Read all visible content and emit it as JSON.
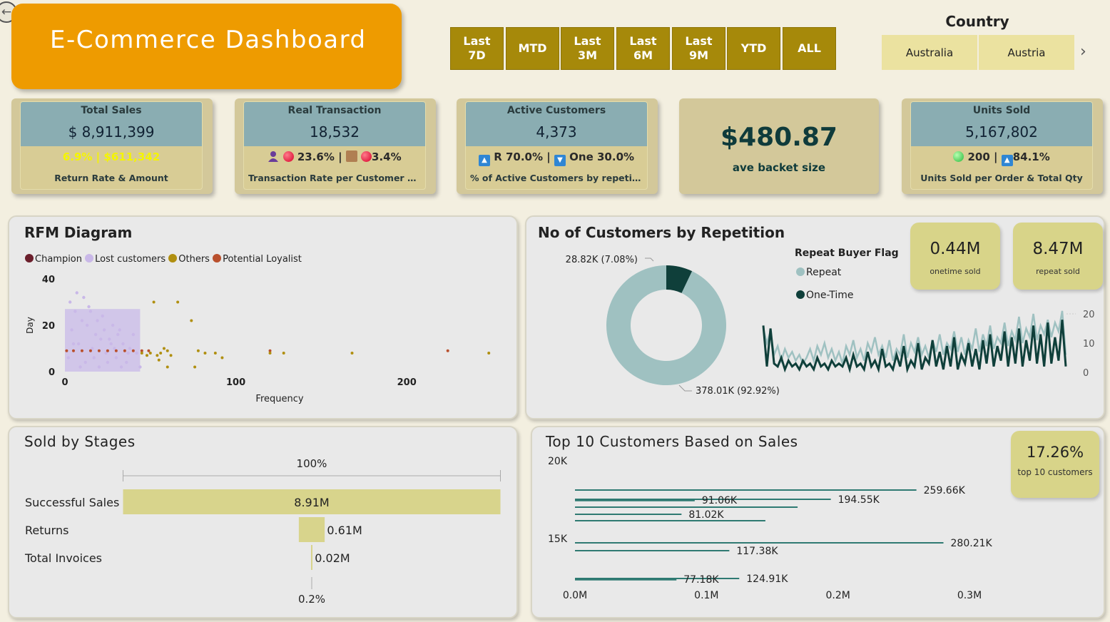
{
  "header": {
    "title": "E-Commerce Dashboard",
    "back_icon": "arrow-left-circle-icon"
  },
  "periods": [
    "Last\n7D",
    "MTD",
    "Last\n3M",
    "Last\n6M",
    "Last\n9M",
    "YTD",
    "ALL"
  ],
  "country": {
    "label": "Country",
    "items": [
      "Australia",
      "Austria"
    ],
    "next_icon": "chevron-right-icon"
  },
  "kpis": {
    "total_sales": {
      "title": "Total Sales",
      "value": "$ 8,911,399",
      "rate": "6.9%",
      "sep": "|",
      "amount": "$611,342",
      "subtitle": "Return Rate & Amount",
      "highlight_color": "#f5f500"
    },
    "real_transaction": {
      "title": "Real Transaction",
      "value": "18,532",
      "rate1": "23.6% |",
      "rate2": "3.4%",
      "subtitle": "Transaction Rate per Customer & Tot..."
    },
    "active_customers": {
      "title": "Active Customers",
      "value": "4,373",
      "repeat": "R 70.0% |",
      "one": "One 30.0%",
      "subtitle": "% of Active Customers by repetition"
    },
    "basket": {
      "value": "$480.87",
      "label": "ave backet size"
    },
    "units_sold": {
      "title": "Units Sold",
      "value": "5,167,802",
      "per_order": "200 |",
      "pct": "84.1%",
      "subtitle": "Units Sold per Order & Total Qty"
    }
  },
  "rfm": {
    "title": "RFM Diagram",
    "legend": [
      {
        "name": "Champion",
        "color": "#6b1f2c"
      },
      {
        "name": "Lost customers",
        "color": "#c9b8e8"
      },
      {
        "name": "Others",
        "color": "#b08f10"
      },
      {
        "name": "Potential Loyalist",
        "color": "#b9502d"
      }
    ]
  },
  "repetition": {
    "title": "No of Customers by Repetition",
    "legend_title": "Repeat Buyer Flag",
    "legend": [
      {
        "name": "Repeat",
        "color": "#9fc1c1"
      },
      {
        "name": "One-Time",
        "color": "#0f3f3a"
      }
    ],
    "onetime": {
      "value": "0.44M",
      "label": "onetime sold"
    },
    "repeat": {
      "value": "8.47M",
      "label": "repeat sold"
    }
  },
  "stages": {
    "title": "Sold by Stages"
  },
  "top10": {
    "title": "Top 10 Customers Based on Sales",
    "card_value": "17.26%",
    "card_label": "top 10 customers"
  },
  "chart_data": [
    {
      "id": "rfm",
      "type": "scatter",
      "title": "RFM Diagram",
      "xlabel": "Frequency",
      "ylabel": "Day",
      "xlim": [
        0,
        250
      ],
      "ylim": [
        0,
        40
      ],
      "xticks": [
        "0",
        "100",
        "200"
      ],
      "yticks": [
        "0",
        "20",
        "40"
      ],
      "series": [
        {
          "name": "Lost customers",
          "points": [
            [
              2,
              6
            ],
            [
              4,
              18
            ],
            [
              6,
              26
            ],
            [
              8,
              12
            ],
            [
              10,
              22
            ],
            [
              12,
              4
            ],
            [
              14,
              28
            ],
            [
              16,
              10
            ],
            [
              18,
              16
            ],
            [
              20,
              2
            ],
            [
              22,
              24
            ],
            [
              24,
              8
            ],
            [
              26,
              14
            ],
            [
              28,
              20
            ],
            [
              30,
              6
            ],
            [
              32,
              18
            ],
            [
              34,
              12
            ],
            [
              36,
              4
            ],
            [
              38,
              10
            ],
            [
              40,
              16
            ],
            [
              42,
              8
            ],
            [
              44,
              2
            ],
            [
              3,
              30
            ],
            [
              7,
              34
            ],
            [
              11,
              32
            ],
            [
              5,
              12
            ],
            [
              9,
              2
            ],
            [
              13,
              20
            ],
            [
              17,
              6
            ],
            [
              21,
              14
            ],
            [
              25,
              4
            ],
            [
              29,
              10
            ],
            [
              33,
              2
            ],
            [
              37,
              8
            ],
            [
              15,
              26
            ],
            [
              19,
              22
            ],
            [
              23,
              18
            ],
            [
              27,
              12
            ],
            [
              31,
              16
            ]
          ]
        },
        {
          "name": "Potential Loyalist",
          "points": [
            [
              1,
              9
            ],
            [
              5,
              9
            ],
            [
              10,
              9
            ],
            [
              15,
              9
            ],
            [
              20,
              9
            ],
            [
              25,
              9
            ],
            [
              30,
              9
            ],
            [
              35,
              9
            ],
            [
              40,
              9
            ],
            [
              45,
              9
            ],
            [
              49,
              9
            ],
            [
              120,
              9
            ],
            [
              224,
              9
            ]
          ]
        },
        {
          "name": "Others",
          "points": [
            [
              52,
              30
            ],
            [
              66,
              30
            ],
            [
              74,
              22
            ],
            [
              45,
              8
            ],
            [
              48,
              7
            ],
            [
              50,
              8
            ],
            [
              54,
              7
            ],
            [
              56,
              8
            ],
            [
              55,
              5
            ],
            [
              58,
              10
            ],
            [
              60,
              9
            ],
            [
              62,
              7
            ],
            [
              60,
              2
            ],
            [
              76,
              2
            ],
            [
              78,
              9
            ],
            [
              82,
              8
            ],
            [
              88,
              8
            ],
            [
              92,
              6
            ],
            [
              120,
              8
            ],
            [
              128,
              8
            ],
            [
              168,
              8
            ],
            [
              248,
              8
            ]
          ]
        },
        {
          "name": "Champion",
          "points": []
        }
      ]
    },
    {
      "id": "repetition_donut",
      "type": "pie",
      "slices": [
        {
          "name": "One-Time",
          "value": 28.82,
          "label": "28.82K (7.08%)"
        },
        {
          "name": "Repeat",
          "value": 378.01,
          "label": "378.01K (92.92%)"
        }
      ]
    },
    {
      "id": "repetition_line",
      "type": "line",
      "ylim": [
        0,
        20
      ],
      "yticks": [
        "0",
        "10",
        "20"
      ],
      "series": [
        {
          "name": "Repeat",
          "values": [
            15,
            10,
            14,
            6,
            9,
            4,
            8,
            5,
            7,
            4,
            6,
            3,
            5,
            8,
            4,
            9,
            6,
            10,
            5,
            8,
            4,
            7,
            3,
            9,
            6,
            11,
            5,
            8,
            4,
            10,
            7,
            12,
            6,
            9,
            5,
            11,
            4,
            8,
            6,
            13,
            5,
            10,
            7,
            12,
            6,
            9,
            5,
            11,
            7,
            13,
            6,
            10,
            8,
            14,
            7,
            12,
            6,
            11,
            8,
            15,
            7,
            13,
            9,
            16,
            8,
            12,
            10,
            17,
            9,
            14,
            11,
            19,
            10,
            15,
            12,
            20,
            11,
            16,
            13,
            18,
            12,
            17,
            14,
            21,
            6
          ]
        },
        {
          "name": "One-Time",
          "values": [
            16,
            2,
            15,
            3,
            2,
            5,
            1,
            4,
            2,
            3,
            1,
            4,
            2,
            3,
            1,
            5,
            2,
            3,
            1,
            4,
            2,
            3,
            2,
            5,
            1,
            6,
            2,
            3,
            1,
            7,
            2,
            4,
            1,
            8,
            2,
            3,
            1,
            6,
            2,
            9,
            1,
            4,
            2,
            10,
            1,
            5,
            3,
            11,
            2,
            7,
            1,
            9,
            2,
            12,
            1,
            6,
            3,
            10,
            2,
            8,
            1,
            11,
            3,
            13,
            2,
            9,
            4,
            14,
            2,
            12,
            3,
            15,
            2,
            11,
            4,
            16,
            3,
            13,
            2,
            17,
            3,
            12,
            4,
            18,
            2
          ]
        }
      ]
    },
    {
      "id": "stages",
      "type": "bar",
      "title": "Sold by Stages",
      "categories": [
        "Successful Sales",
        "Returns",
        "Total Invoices"
      ],
      "values": [
        8.91,
        0.61,
        0.02
      ],
      "value_labels": [
        "8.91M",
        "0.61M",
        "0.02M"
      ],
      "top_label": "100%",
      "bottom_label": "0.2%",
      "bar_color": "#d8d48c"
    },
    {
      "id": "top10",
      "type": "bar",
      "title": "Top 10 Customers Based on Sales",
      "xlim": [
        0,
        0.3
      ],
      "xticks": [
        "0.0M",
        "0.1M",
        "0.2M",
        "0.3M"
      ],
      "yticks": [
        "20K",
        "15K"
      ],
      "values": [
        {
          "value": 259.66,
          "label": "259.66K"
        },
        {
          "value": 194.55,
          "label": "194.55K"
        },
        {
          "value": 91.06,
          "label": "91.06K"
        },
        {
          "value": 169.3,
          "label": ""
        },
        {
          "value": 81.02,
          "label": "81.02K"
        },
        {
          "value": 144.8,
          "label": ""
        },
        {
          "value": 280.21,
          "label": "280.21K"
        },
        {
          "value": 117.38,
          "label": "117.38K"
        },
        {
          "value": 124.91,
          "label": "124.91K"
        },
        {
          "value": 77.18,
          "label": "77.18K"
        }
      ],
      "bar_color": "#2f7a72"
    }
  ]
}
